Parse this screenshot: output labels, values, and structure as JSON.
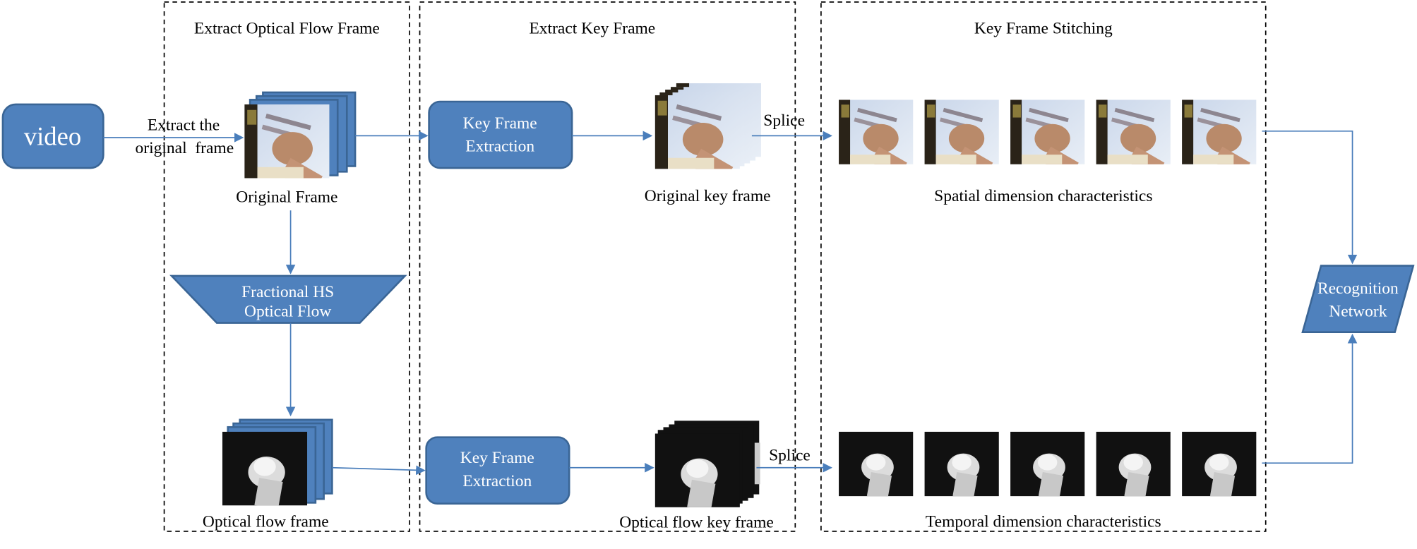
{
  "sections": {
    "optical_flow": "Extract Optical Flow Frame",
    "key_frame": "Extract Key Frame",
    "stitching": "Key Frame Stitching"
  },
  "nodes": {
    "video": "video",
    "fractional_line1": "Fractional HS",
    "fractional_line2": "Optical Flow",
    "kfe_top_line1": "Key Frame",
    "kfe_top_line2": "Extraction",
    "kfe_bottom_line1": "Key Frame",
    "kfe_bottom_line2": "Extraction",
    "recog_line1": "Recognition",
    "recog_line2": "Network"
  },
  "labels": {
    "extract_line1": "Extract the",
    "extract_line2": "original  frame",
    "original_frame": "Original Frame",
    "optical_flow_frame": "Optical flow frame",
    "original_key_frame": "Original key frame",
    "optical_flow_key_frame": "Optical flow key frame",
    "splice_top": "Splice",
    "splice_bottom": "Splice",
    "spatial": "Spatial dimension characteristics",
    "temporal": "Temporal dimension characteristics"
  },
  "colors": {
    "node_fill": "#4f81bd",
    "arrow": "#4a7ebb"
  }
}
